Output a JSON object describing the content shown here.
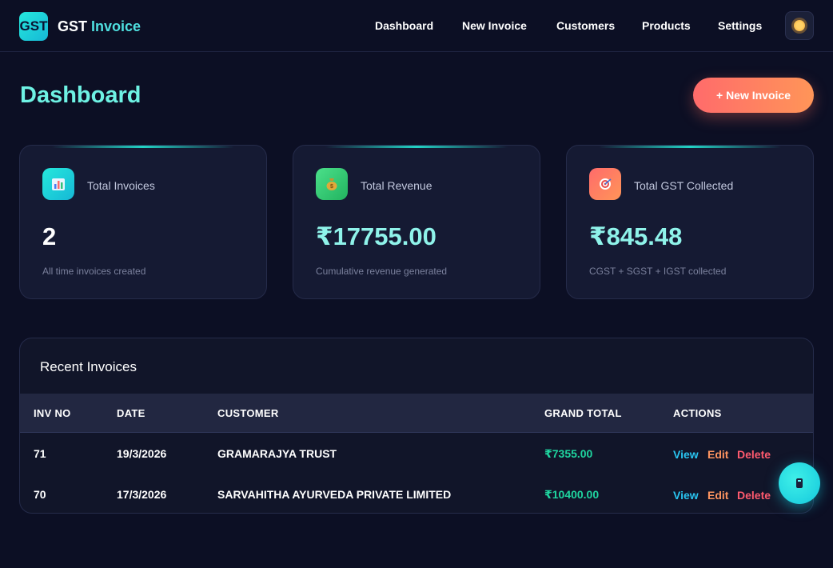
{
  "brand": {
    "logo_text": "GST",
    "name_prefix": "GST",
    "name_accent": "Invoice"
  },
  "nav": {
    "links": [
      "Dashboard",
      "New Invoice",
      "Customers",
      "Products",
      "Settings"
    ],
    "theme_icon": "sun-icon"
  },
  "page": {
    "title": "Dashboard",
    "new_invoice_label": "+ New Invoice"
  },
  "stats": [
    {
      "icon": "bar-chart-icon",
      "icon_bg": "#19d3e6",
      "label": "Total Invoices",
      "value": "2",
      "sub": "All time invoices created"
    },
    {
      "icon": "money-bag-icon",
      "icon_bg": "#2ecc71",
      "label": "Total Revenue",
      "value": "₹17755.00",
      "sub": "Cumulative revenue generated"
    },
    {
      "icon": "target-icon",
      "icon_bg": "#ff7a5c",
      "label": "Total GST Collected",
      "value": "₹845.48",
      "sub": "CGST + SGST + IGST collected"
    }
  ],
  "recent": {
    "title": "Recent Invoices",
    "columns": [
      "INV NO",
      "DATE",
      "CUSTOMER",
      "GRAND TOTAL",
      "ACTIONS"
    ],
    "rows": [
      {
        "inv_no": "71",
        "date": "19/3/2026",
        "customer": "GRAMARAJYA TRUST",
        "total": "₹7355.00"
      },
      {
        "inv_no": "70",
        "date": "17/3/2026",
        "customer": "SARVAHITHA AYURVEDA PRIVATE LIMITED",
        "total": "₹10400.00"
      }
    ],
    "actions": {
      "view": "View",
      "edit": "Edit",
      "delete": "Delete"
    }
  },
  "fab": {
    "icon": "calculator-icon"
  },
  "colors": {
    "background": "#0c0f24",
    "accent": "#6ef2e4",
    "primary_button": "#ff6b6b",
    "total_green": "#1fd6a0"
  }
}
